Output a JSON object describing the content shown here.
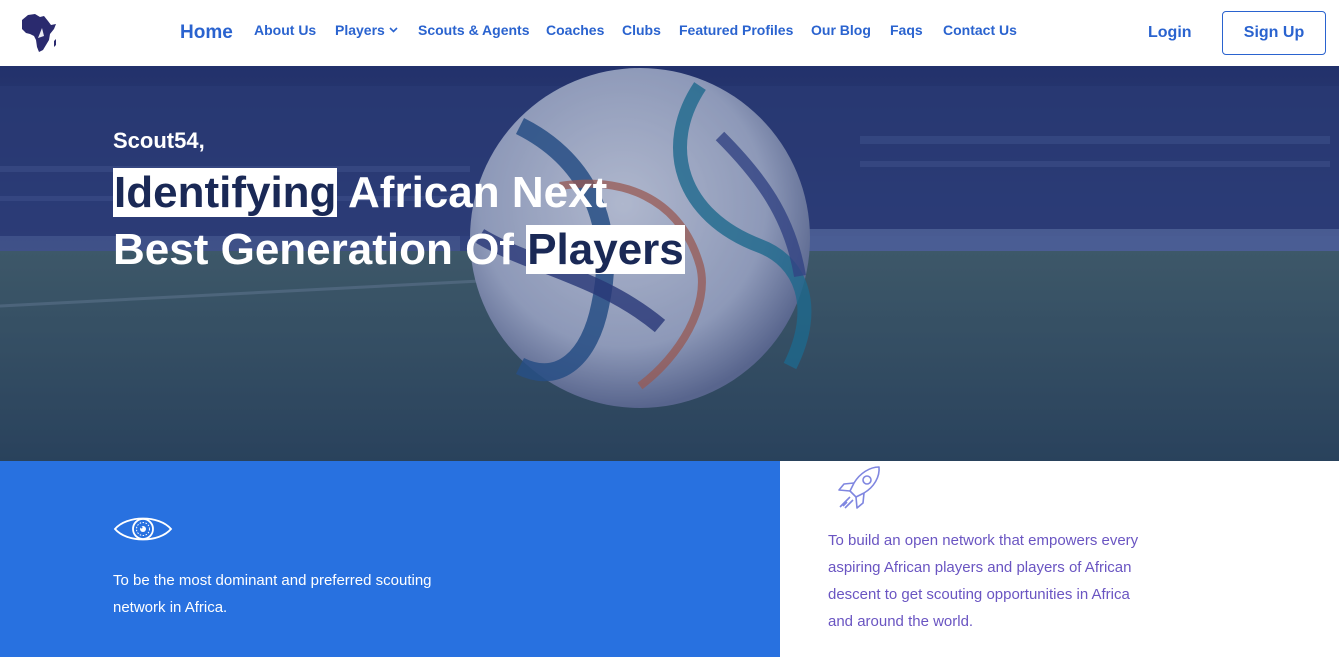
{
  "nav": {
    "logo_icon": "africa-map-logo",
    "home": "Home",
    "links": [
      {
        "label": "About Us"
      },
      {
        "label": "Players"
      },
      {
        "label": "Scouts & Agents"
      },
      {
        "label": "Coaches"
      },
      {
        "label": "Clubs"
      },
      {
        "label": "Featured Profiles"
      },
      {
        "label": "Our Blog"
      },
      {
        "label": "Faqs"
      },
      {
        "label": "Contact Us"
      }
    ],
    "login": "Login",
    "signup": "Sign Up"
  },
  "hero": {
    "eyebrow": "Scout54,",
    "title_highlight_1": "Identifying",
    "title_part_1": " African Next Best Generation Of ",
    "title_highlight_2": "Players",
    "background": "football-stadium-photo"
  },
  "vision": {
    "icon": "eye-icon",
    "text": "To be the most dominant and preferred scouting network in Africa."
  },
  "mission": {
    "icon": "rocket-icon",
    "text": "To build an open network that empowers every aspiring African players and players of African descent to get scouting opportunities in Africa and around the world."
  },
  "colors": {
    "primary": "#2a63cf",
    "vision_bg": "#2871e0",
    "hero_overlay": "#2b3c78",
    "highlight_text": "#1a2956",
    "mission_text": "#6a55c2"
  }
}
